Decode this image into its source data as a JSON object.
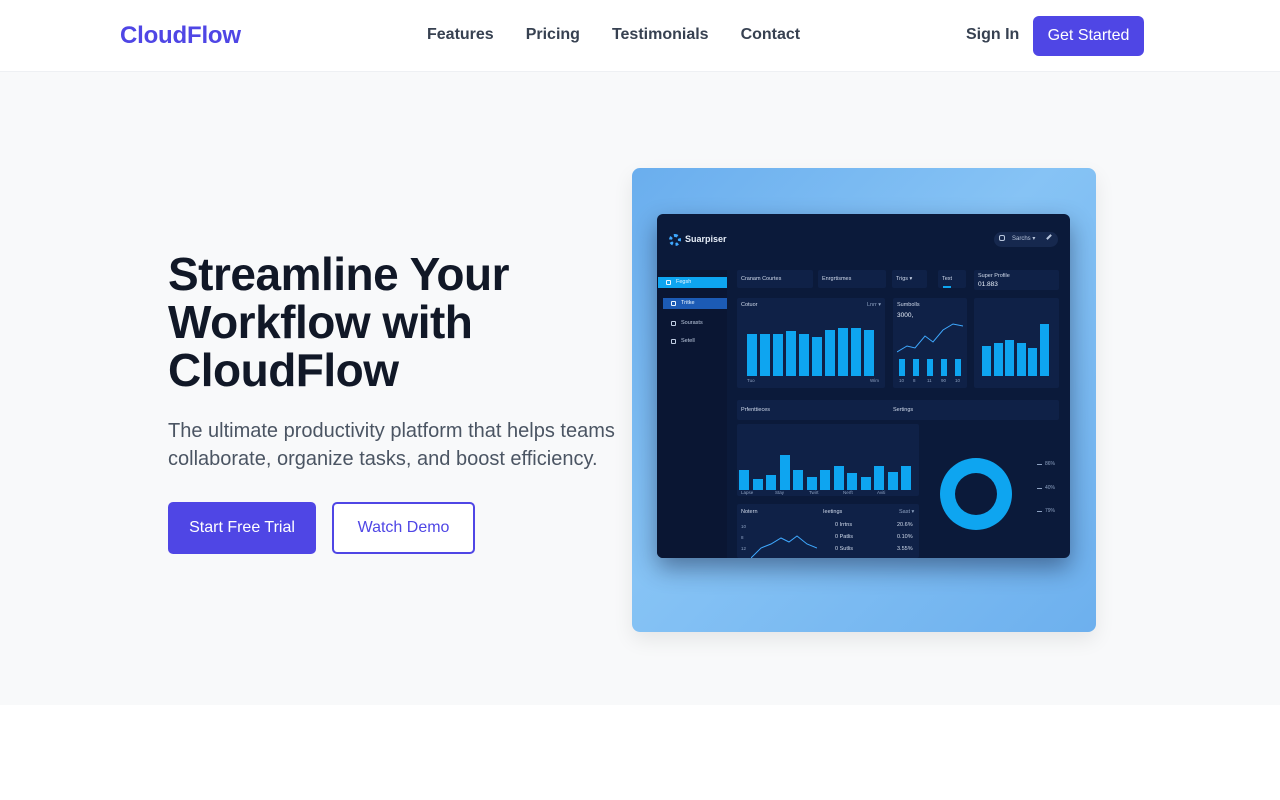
{
  "nav": {
    "logo": "CloudFlow",
    "links": [
      "Features",
      "Pricing",
      "Testimonials",
      "Contact"
    ],
    "sign_in": "Sign In",
    "get_started": "Get Started"
  },
  "hero": {
    "title": "Streamline Your Workflow with CloudFlow",
    "subtitle": "The ultimate productivity platform that helps teams collaborate, organize tasks, and boost efficiency.",
    "primary_cta": "Start Free Trial",
    "secondary_cta": "Watch Demo"
  },
  "illustration": {
    "brand": "Suarpiser",
    "search": "Sarchs ▾",
    "sidebar": [
      "Fegsh",
      "Tritke",
      "Sourasts",
      "Setell"
    ],
    "tabs": [
      "Cranam Courtes",
      "Enrgrtismes",
      "Trigs ▾",
      "Text"
    ],
    "profile_label": "Super Profile",
    "profile_value": "01.883",
    "panel1_title": "Cotuor",
    "panel1_range": "Lnrr ▾",
    "panel1_xlabels": [
      "Tuo",
      "Wim"
    ],
    "panel1_bars": [
      0.72,
      0.72,
      0.72,
      0.78,
      0.72,
      0.68,
      0.8,
      0.82,
      0.82,
      0.8
    ],
    "panel2_title": "Sumbolls",
    "panel2_value": "3000,",
    "panel2_bars": [
      0.55,
      0.55,
      0.55,
      0.55,
      0.55
    ],
    "panel2_xlabels": [
      "10",
      "8",
      "11",
      "90",
      "10"
    ],
    "panel3_bars": [
      0.55,
      0.6,
      0.65,
      0.6,
      0.5,
      0.95
    ],
    "section_left": "Prfenttieces",
    "section_right": "Sertings",
    "panel4_bars": [
      0.45,
      0.25,
      0.35,
      0.8,
      0.45,
      0.3,
      0.45,
      0.55,
      0.38,
      0.3,
      0.55,
      0.4,
      0.55
    ],
    "panel4_xlabels": [
      "Lapse",
      "Stay",
      "Twirt",
      "Nerft",
      "Aviti"
    ],
    "donut_legend": [
      "86%",
      "40%",
      "79%"
    ],
    "table_title": "Notern",
    "table_col": "Ieetings",
    "table_filter": "Sast ▾",
    "table_rows": [
      {
        "name": "0 Irrtns",
        "val": "20.6%"
      },
      {
        "name": "0 Patlis",
        "val": "0.10%"
      },
      {
        "name": "0 Sutlis",
        "val": "3.55%"
      }
    ],
    "line_axis": [
      "10",
      "8",
      "12"
    ]
  }
}
